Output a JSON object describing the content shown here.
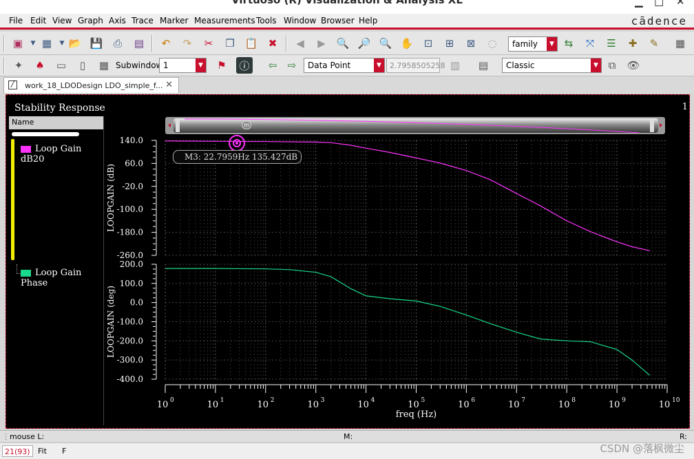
{
  "window": {
    "title": "Virtuoso (R) Visualization & Analysis XL"
  },
  "menubar": {
    "items": [
      "File",
      "Edit",
      "View",
      "Graph",
      "Axis",
      "Trace",
      "Marker",
      "Measurements",
      "Tools",
      "Window",
      "Browser",
      "Help"
    ],
    "brand": "cādence"
  },
  "toolbar1": {
    "family_combo": "family"
  },
  "toolbar2": {
    "subwindow_label": "Subwindow:",
    "subwindow_value": "1",
    "data_point_combo": "Data Point",
    "data_point_value": "2.7958505258",
    "style_combo": "Classic"
  },
  "tab": {
    "label": "work_18_LDODesign LDO_simple_f..."
  },
  "plot": {
    "title": "Stability Response",
    "subwindow_number": "1",
    "legend_header": "Name",
    "marker_label": "M3: 22.7959Hz 135.427dB",
    "marker_handle": "m"
  },
  "colors": {
    "gain": "#ff33ff",
    "phase": "#19d98c",
    "accent": "#c8102e",
    "legend_bar": "#f5f000"
  },
  "chart_data": [
    {
      "type": "line",
      "title": "",
      "xlabel": "freq (Hz)",
      "ylabel": "LOOPGAIN (dB)",
      "xscale": "log",
      "xlim": [
        1,
        10000000000
      ],
      "ylim": [
        -260,
        140
      ],
      "yticks": [
        "140.0",
        "60.0",
        "-20.0",
        "-100.0",
        "-180.0",
        "-260.0"
      ],
      "grid": true,
      "series": [
        {
          "name": "Loop Gain dB20",
          "color": "#ff33ff",
          "x": [
            1,
            10,
            100,
            1000,
            2000,
            5000,
            10000,
            30000,
            100000,
            300000,
            1000000,
            3000000,
            10000000,
            30000000,
            100000000,
            300000000,
            1000000000,
            2000000000,
            4500000000
          ],
          "y": [
            138,
            137,
            136,
            134,
            132,
            123,
            113,
            98,
            79,
            61,
            35,
            3,
            -45,
            -88,
            -140,
            -178,
            -213,
            -230,
            -244
          ]
        }
      ],
      "marker": {
        "name": "M3",
        "x": 22.7959,
        "y": 135.427
      }
    },
    {
      "type": "line",
      "title": "",
      "xlabel": "freq (Hz)",
      "ylabel": "LOOPGAIN (deg)",
      "xscale": "log",
      "xlim": [
        1,
        10000000000
      ],
      "ylim": [
        -400,
        200
      ],
      "yticks": [
        "200.0",
        "100.0",
        "0.0",
        "-100.0",
        "-200.0",
        "-300.0",
        "-400.0"
      ],
      "grid": true,
      "series": [
        {
          "name": "Loop Gain Phase",
          "color": "#19d98c",
          "x": [
            1,
            10,
            100,
            300,
            1000,
            2000,
            5000,
            10000,
            30000,
            100000,
            300000,
            1000000,
            3000000,
            10000000,
            30000000,
            100000000,
            300000000,
            1000000000,
            2000000000,
            4500000000
          ],
          "y": [
            178,
            178,
            176,
            172,
            158,
            135,
            72,
            35,
            20,
            8,
            -20,
            -65,
            -110,
            -155,
            -190,
            -200,
            -205,
            -245,
            -300,
            -380
          ]
        }
      ]
    }
  ],
  "xaxis_ticks": [
    "10",
    "10",
    "10",
    "10",
    "10",
    "10",
    "10",
    "10",
    "10",
    "10",
    "10"
  ],
  "xaxis_exponents": [
    "0",
    "1",
    "2",
    "3",
    "4",
    "5",
    "6",
    "7",
    "8",
    "9",
    "10"
  ],
  "status": {
    "mouse_left": "mouse L:",
    "mouse_middle": "M:",
    "mouse_right": "R:",
    "counter": "21(93)",
    "mode": "Fit",
    "flag": "F"
  },
  "watermark": "CSDN @落枫微尘"
}
